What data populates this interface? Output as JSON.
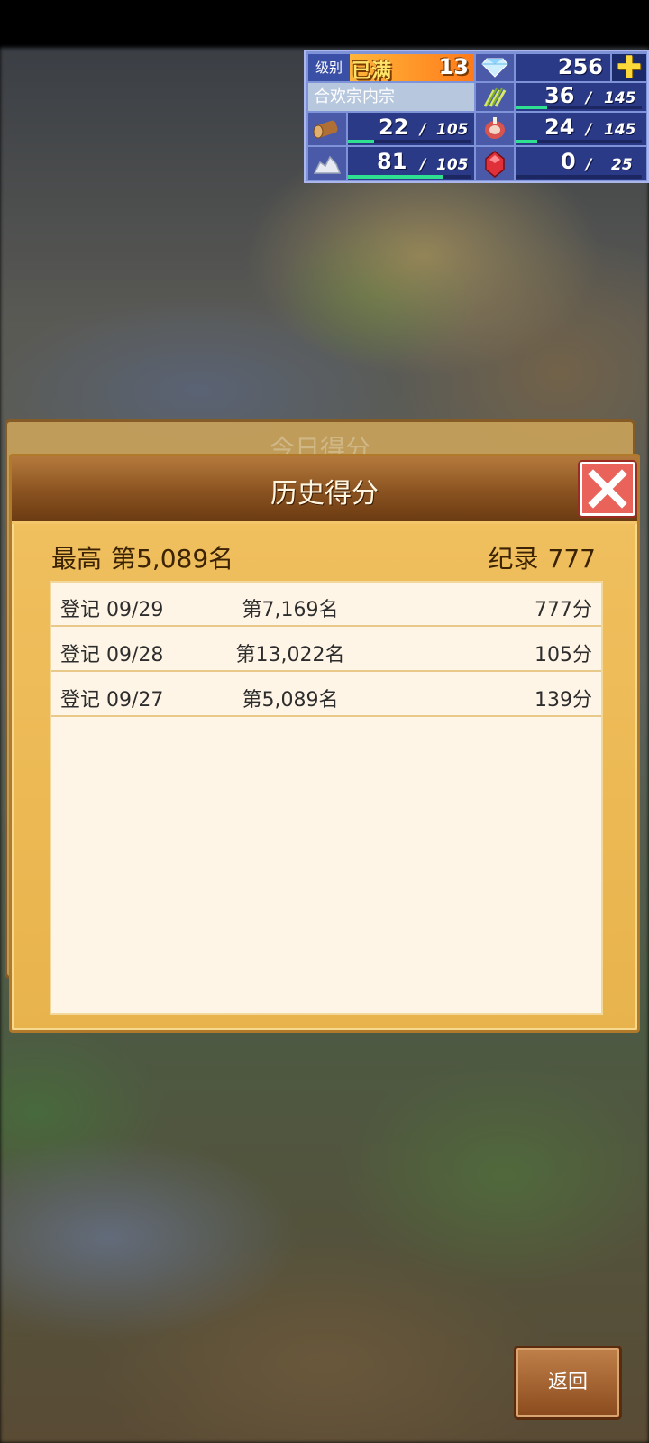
{
  "hud": {
    "level_label": "级别",
    "level_status": "已满",
    "level_value": "13",
    "gems": "256",
    "sect_name": "合欢宗内宗",
    "resources": [
      {
        "icon": "grain-icon",
        "value": "36",
        "max": "145",
        "fill": 0.25
      },
      {
        "icon": "wood-log-icon",
        "value": "22",
        "max": "105",
        "fill": 0.21
      },
      {
        "icon": "meat-icon",
        "value": "24",
        "max": "145",
        "fill": 0.17
      },
      {
        "icon": "ore-icon",
        "value": "81",
        "max": "105",
        "fill": 0.77
      },
      {
        "icon": "ruby-icon",
        "value": "0",
        "max": "25",
        "fill": 0.0
      }
    ],
    "colors": {
      "bar_fill": "#2ee08f",
      "hud_bg": "#2a3a86"
    }
  },
  "back_panel": {
    "title": "今日得分"
  },
  "panel": {
    "title": "历史得分",
    "best_label": "最高",
    "best_rank": "第5,089名",
    "record_label": "纪录",
    "record_value": "777",
    "rows": [
      {
        "date": "登记 09/29",
        "rank": "第7,169名",
        "score": "777分"
      },
      {
        "date": "登记 09/28",
        "rank": "第13,022名",
        "score": "105分"
      },
      {
        "date": "登记 09/27",
        "rank": "第5,089名",
        "score": "139分"
      }
    ]
  },
  "return_label": "返回"
}
